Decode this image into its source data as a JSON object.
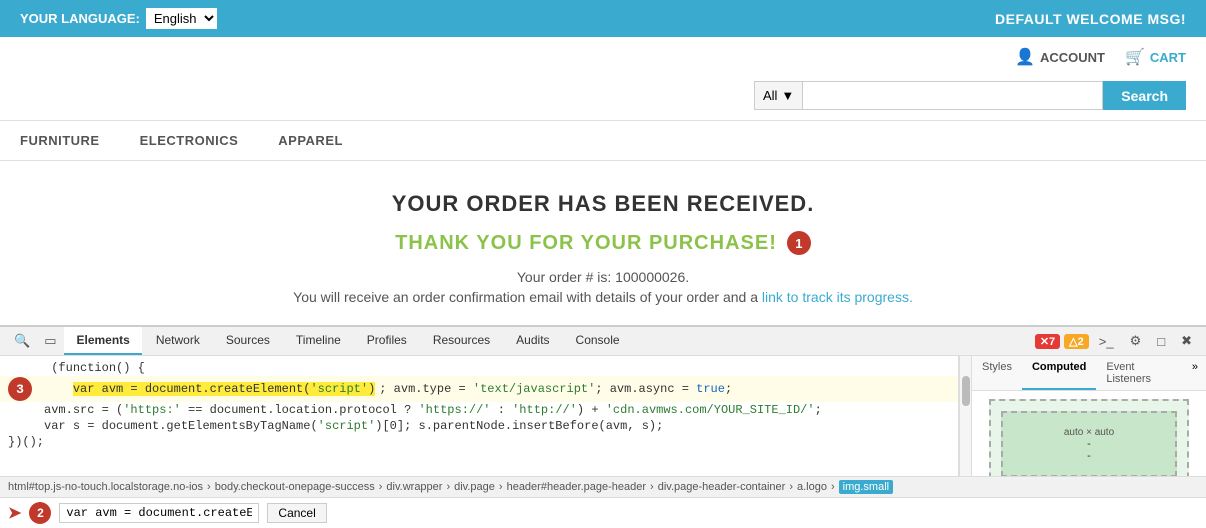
{
  "topbar": {
    "language_label": "YOUR LANGUAGE:",
    "language_value": "English",
    "welcome_msg": "DEFAULT WELCOME MSG!"
  },
  "header": {
    "account_label": "ACCOUNT",
    "cart_label": "CART"
  },
  "search": {
    "category": "All",
    "placeholder": "",
    "button_label": "Search"
  },
  "nav": {
    "items": [
      {
        "label": "FURNITURE"
      },
      {
        "label": "ELECTRONICS"
      },
      {
        "label": "APPAREL"
      }
    ]
  },
  "main": {
    "order_received": "YOUR ORDER HAS BEEN RECEIVED.",
    "thank_you": "THANK YOU FOR YOUR PURCHASE!",
    "badge1": "1",
    "order_info": "Your order # is: 100000026.",
    "confirm_text": "You will receive an order confirmation email with details of your order and a ",
    "track_link_text": "link to track its progress."
  },
  "devtools": {
    "tabs": [
      {
        "label": "Elements",
        "active": true
      },
      {
        "label": "Network"
      },
      {
        "label": "Sources"
      },
      {
        "label": "Timeline"
      },
      {
        "label": "Profiles"
      },
      {
        "label": "Resources"
      },
      {
        "label": "Audits"
      },
      {
        "label": "Console"
      }
    ],
    "error_count": "7",
    "warn_count": "2",
    "code_lines": [
      {
        "text": "(function() {",
        "highlighted": false
      },
      {
        "text": "    var avm = document.createElement('script'); avm.type = 'text/javascript'; avm.async = true;",
        "highlighted": true
      },
      {
        "text": "    avm.src = ('https:' == document.location.protocol ? 'https://' : 'http://') + 'cdn.avmws.com/YOUR_SITE_ID/';",
        "highlighted": false
      },
      {
        "text": "    var s = document.getElementsByTagName('script')[0]; s.parentNode.insertBefore(avm, s);",
        "highlighted": false
      },
      {
        "text": "})();",
        "highlighted": false
      }
    ],
    "badge3": "3",
    "styles_tabs": [
      {
        "label": "Styles",
        "active": false
      },
      {
        "label": "Computed",
        "active": true
      },
      {
        "label": "Event Listeners",
        "active": false
      }
    ],
    "styles_more": "»",
    "box_model_label": "auto × auto",
    "box_dash1": "-",
    "box_dash2": "-",
    "breadcrumbs": [
      {
        "label": "html#top.js-no-touch.localstorage.no-ios",
        "selected": false
      },
      {
        "label": "body.checkout-onepage-success",
        "selected": false
      },
      {
        "label": "div.wrapper",
        "selected": false
      },
      {
        "label": "div.page",
        "selected": false
      },
      {
        "label": "header#header.page-header",
        "selected": false
      },
      {
        "label": "div.page-header-container",
        "selected": false
      },
      {
        "label": "a.logo",
        "selected": false
      },
      {
        "label": "img.small",
        "selected": true
      }
    ],
    "bottom_input_value": "var avm = document.createElem",
    "badge2": "2",
    "cancel_label": "Cancel"
  }
}
